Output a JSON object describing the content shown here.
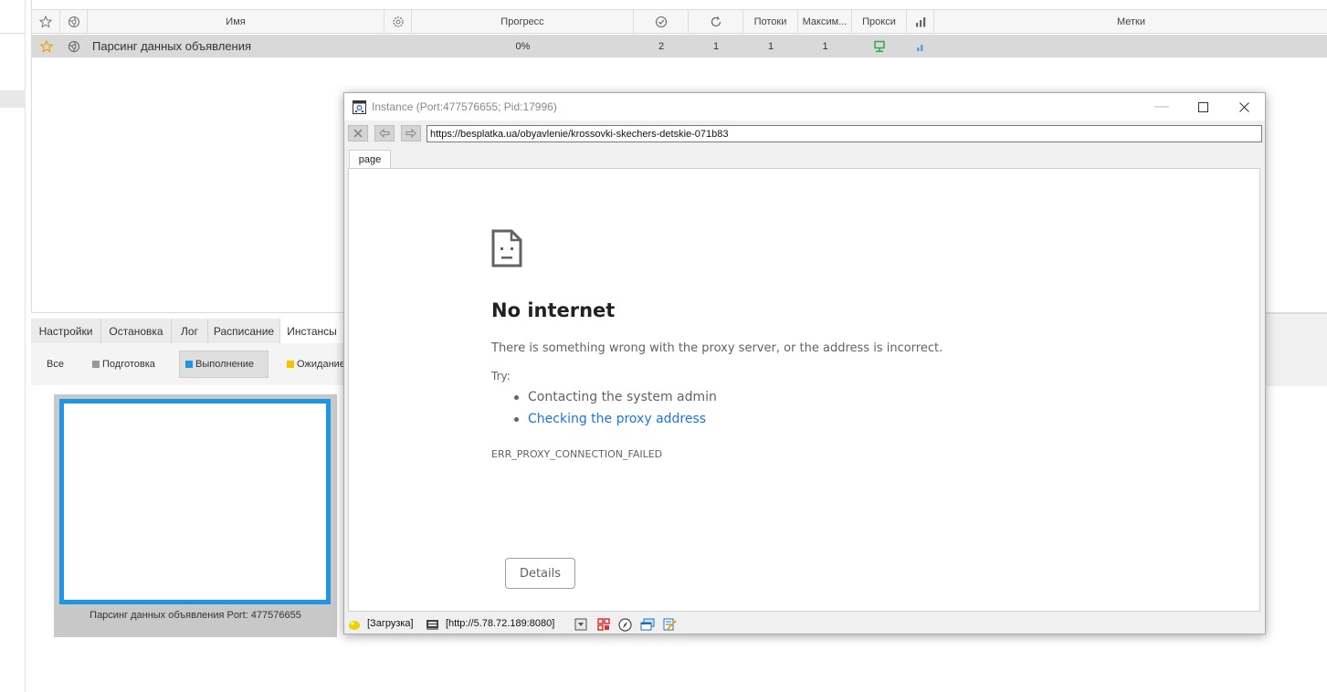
{
  "table": {
    "columns": {
      "name": "Имя",
      "progress": "Прогресс",
      "threads": "Потоки",
      "max": "Максим...",
      "proxy": "Прокси",
      "tags": "Метки"
    },
    "row": {
      "name": "Парсинг данных объявления",
      "progress": "0%",
      "successes": "2",
      "retries": "1",
      "threads": "1",
      "max": "1"
    }
  },
  "bottom_tabs": [
    "Настройки",
    "Остановка",
    "Лог",
    "Расписание",
    "Инстансы"
  ],
  "filters": {
    "all": "Все",
    "prep": "Подготовка",
    "running": "Выполнение",
    "waiting": "Ожидание"
  },
  "thumbnail": {
    "caption": "Парсинг данных объявления Port: 477576655"
  },
  "instance_window": {
    "title": "Instance (Port:477576655; Pid:17996)",
    "url": "https://besplatka.ua/obyavlenie/krossovki-skechers-detskie-071b83",
    "page_tab": "page",
    "error": {
      "title": "No internet",
      "description": "There is something wrong with the proxy server, or the address is incorrect.",
      "try_label": "Try:",
      "suggestion_1": "Contacting the system admin",
      "suggestion_2": "Checking the proxy address",
      "code": "ERR_PROXY_CONNECTION_FAILED",
      "details_button": "Details"
    },
    "status": {
      "state": "[Загрузка]",
      "proxy": "[http://5.78.72.189:8080]"
    }
  },
  "colors": {
    "accent_blue": "#1e96e6",
    "star": "#f0a30a",
    "proxy_green": "#2fa84f",
    "link": "#1a73e8"
  }
}
